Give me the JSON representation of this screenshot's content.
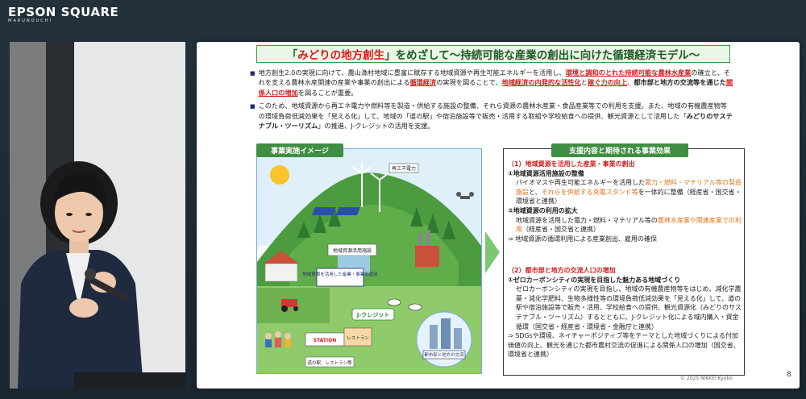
{
  "brand": {
    "name": "EPSON SQUARE",
    "sub": "MARUNOUCHI"
  },
  "slide": {
    "title_pre": "「",
    "title_highlight": "みどりの地方創生",
    "title_post": "」をめざして～持続可能な産業の創出に向けた循環経済モデル～",
    "intro_1": "地方創生2.0の実現に向けて、農山漁村地域に豊富に賦存する地域資源や再生可能エネルギーを活用し、",
    "intro_1_red": "環境と調和のとれた持続可能な農林水産業",
    "intro_1b": "の確立と、それを支える農林水産関連の産業や事業の創出による",
    "intro_1_red2": "循環経済",
    "intro_1c": "の実現を図ることで、",
    "intro_1_red3": "地域経済の内発的な活性化",
    "intro_1d": "と",
    "intro_1_red4": "稼ぐ力の向上",
    "intro_1e": "、",
    "intro_1_bold": "都市部と地方の交流等を通じた",
    "intro_1_red5": "関係人口の増加",
    "intro_1f": "を図ることが重要。",
    "intro_2": "このため、地域資源から再エネ電力や燃料等を製造・供給する施設の整備、それら資源の農林水産業・食品産業等での利用を支援。また、地域の有機農産物等の環境負荷低減効果を「見える化」して、地域の「道の駅」や宿泊施設等で販売・活用する取組や学校給食への提供、観光資源として活用した「",
    "intro_2_bold": "みどりのサステナブル・ツーリズム",
    "intro_2b": "」の推進、J-クレジットの活用を支援。",
    "left_box_header": "事業実施イメージ",
    "right_box_header": "支援内容と期待される事業効果",
    "copyright": "© 2025 NIKKEI Kyobo",
    "page_number": "8"
  },
  "illustration": {
    "label_1": "再エネ電力",
    "label_2": "地域資源活用施設",
    "label_3": "地域資源を活用した産業・事業の創出",
    "label_4": "J-クレジット",
    "label_5": "STATION",
    "label_6": "レストラン",
    "label_7": "都市部と地方の交流",
    "label_8": "道の駅、レストラン等"
  },
  "right": {
    "s1_title": "（1）地域資源を活用した産業・事業の創出",
    "s1_a": "①地域資源活用施設の整備",
    "s1_a_text_1": "バイオマスや再生可能エネルギーを活用した",
    "s1_a_orange": "電力・燃料・マテリアル等の製造施設",
    "s1_a_text_2": "と、",
    "s1_a_orange2": "それらを供給する充電スタンド等",
    "s1_a_text_3": "を一体的に整備（経産省・国交省・環境省と連携）",
    "s1_b": "②地域資源の利用の拡大",
    "s1_b_text_1": "地域資源を活用した電力・燃料・マテリアル等の",
    "s1_b_orange": "農林水産業や関連産業での利用",
    "s1_b_text_2": "（経産省・国交省と連携）",
    "s1_result": "⇒ 地域資源の循環利用による産業創出、雇用の確保",
    "s2_title": "（2）都市部と地方の交流人口の増加",
    "s2_a": "①ゼロカーボンシティの実現を目指した魅力ある地域づくり",
    "s2_a_text": "ゼロカーボンシティの実現を目指し、地域の有機農産物等をはじめ、減化学農薬・減化学肥料、生物多様性等の環境負荷低減効果を「見える化」して、道の駅や宿泊施設等で販売・活用、学校給食への提供、観光資源化（みどりのサステナブル・ツーリズム）するとともに、J-クレジット化による域内購入・資金循環（国交省・経産省・環境省・金融庁と連携）",
    "s2_result": "⇒ SDGsや環境、ネイチャーポジティブ等をテーマとした地域づくりによる付加価値の向上、観光を通じた都市農村交流の促進による関係人口の増加（国交省、環境省と連携）"
  },
  "colors": {
    "accent_green": "#3f8e43",
    "accent_red": "#d21f1f",
    "accent_orange": "#e0741a"
  }
}
